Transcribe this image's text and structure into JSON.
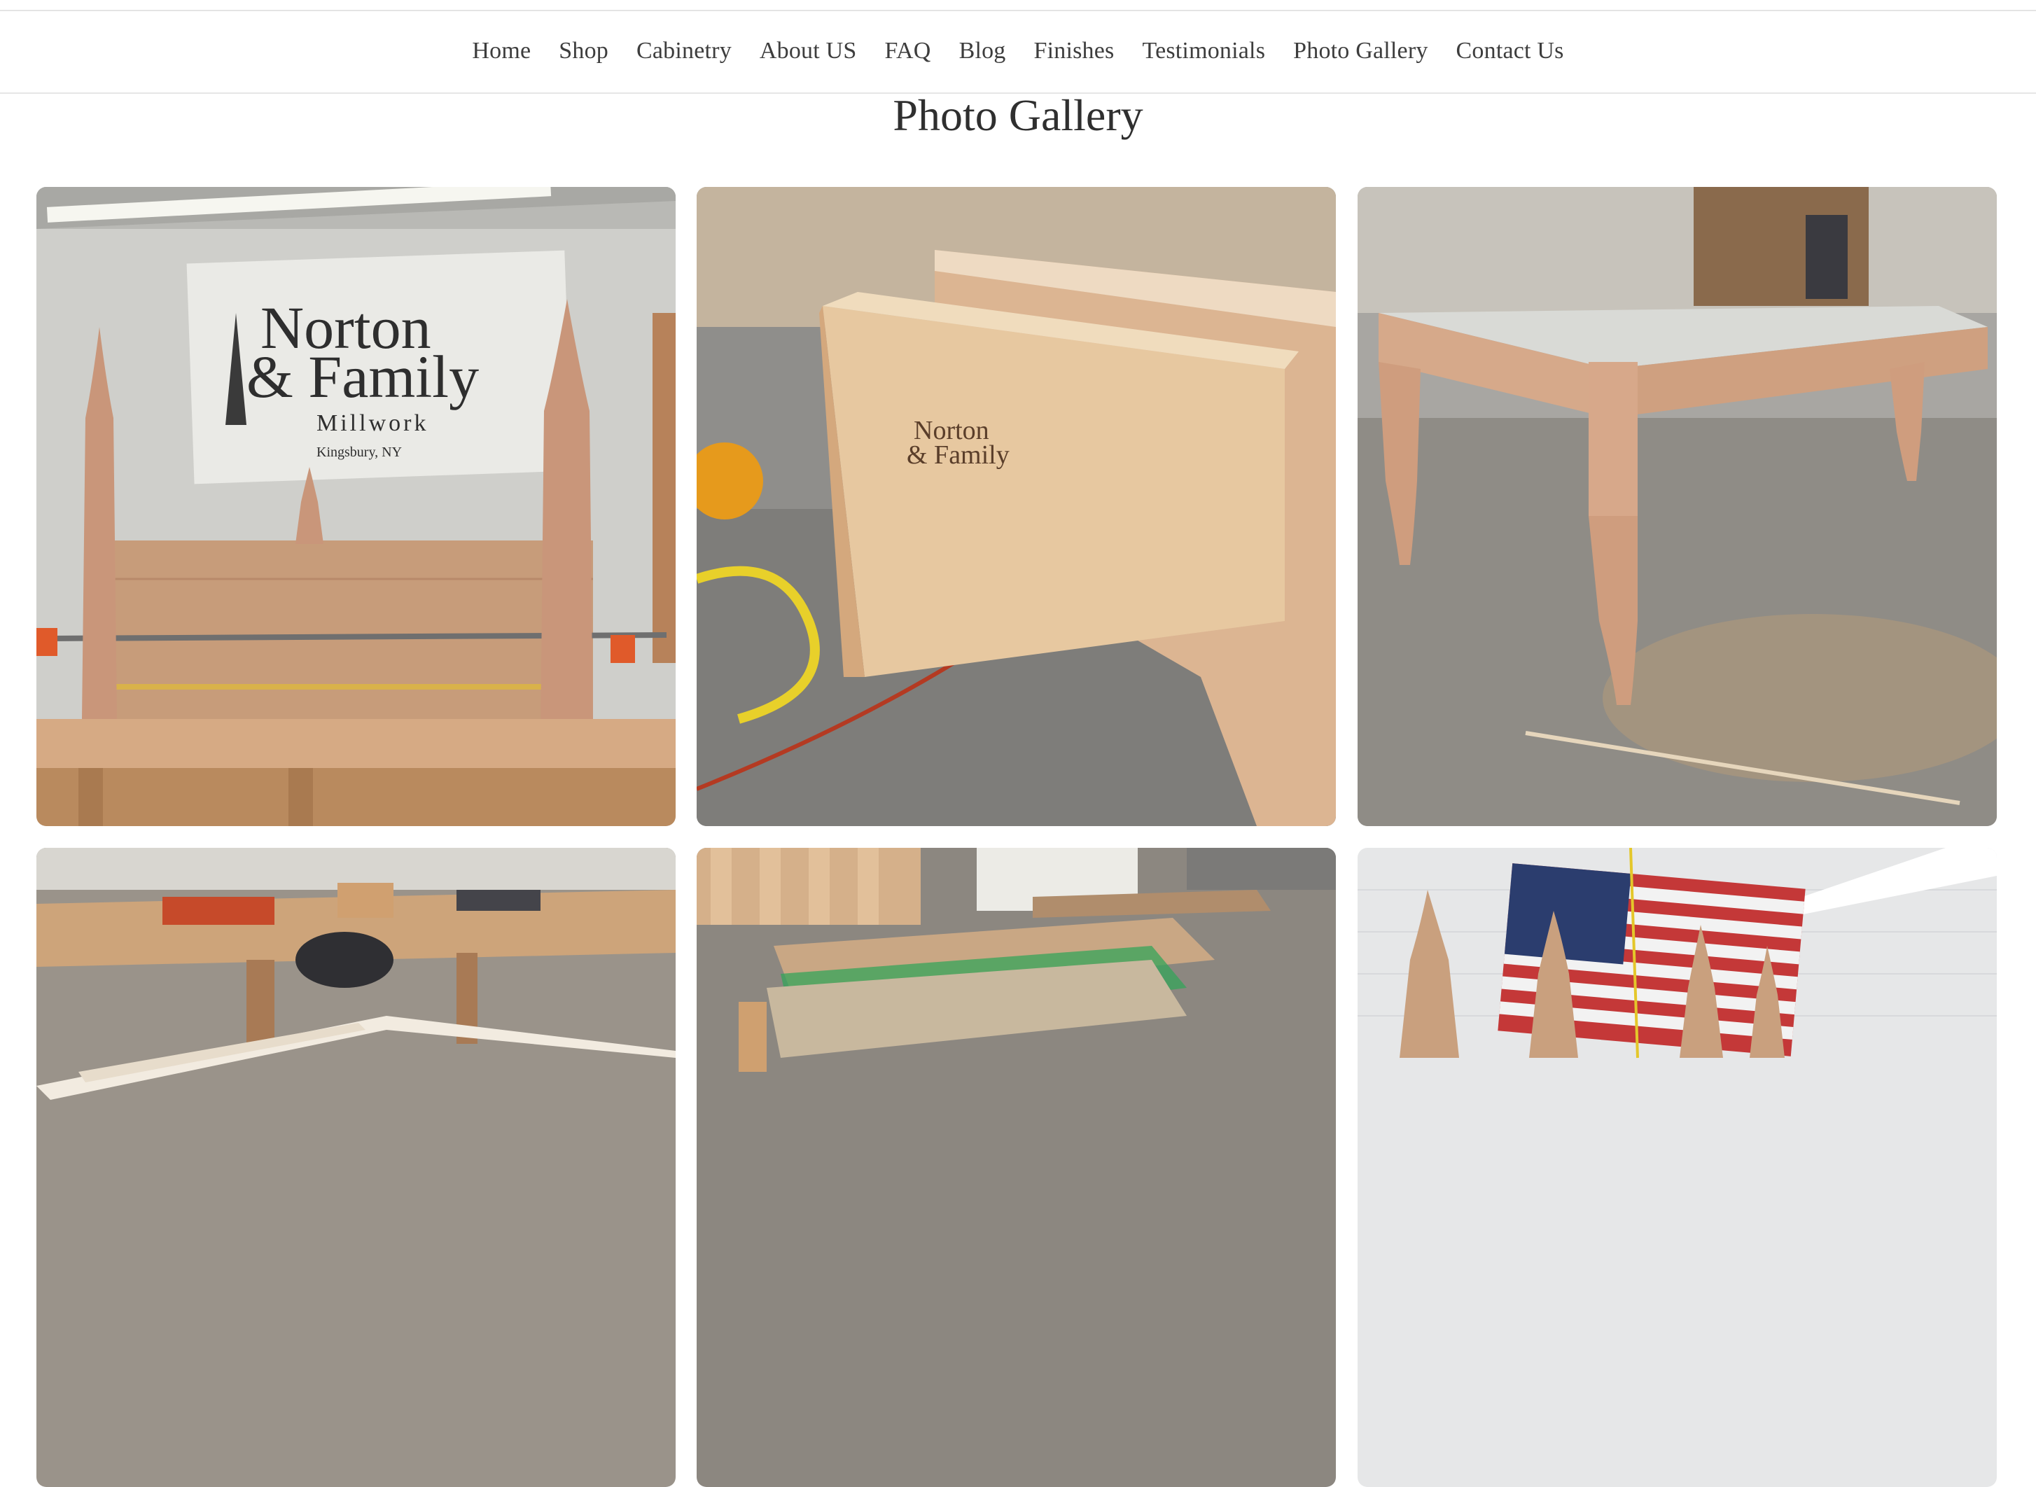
{
  "nav": {
    "items": [
      "Home",
      "Shop",
      "Cabinetry",
      "About US",
      "FAQ",
      "Blog",
      "Finishes",
      "Testimonials",
      "Photo Gallery",
      "Contact Us"
    ]
  },
  "page": {
    "title": "Photo Gallery"
  },
  "photos": [
    {
      "name": "bed-frame-photo",
      "banner_line1": "Norton",
      "banner_line2": "& Family",
      "banner_line3": "Millwork",
      "banner_line4": "Kingsbury, NY"
    },
    {
      "name": "dovetail-drawer-photo",
      "logo_line1": "Norton",
      "logo_line2": "& Family"
    },
    {
      "name": "table-frame-photo"
    },
    {
      "name": "workbench-photo"
    },
    {
      "name": "crated-furniture-photo"
    },
    {
      "name": "turned-posts-flag-photo"
    }
  ]
}
